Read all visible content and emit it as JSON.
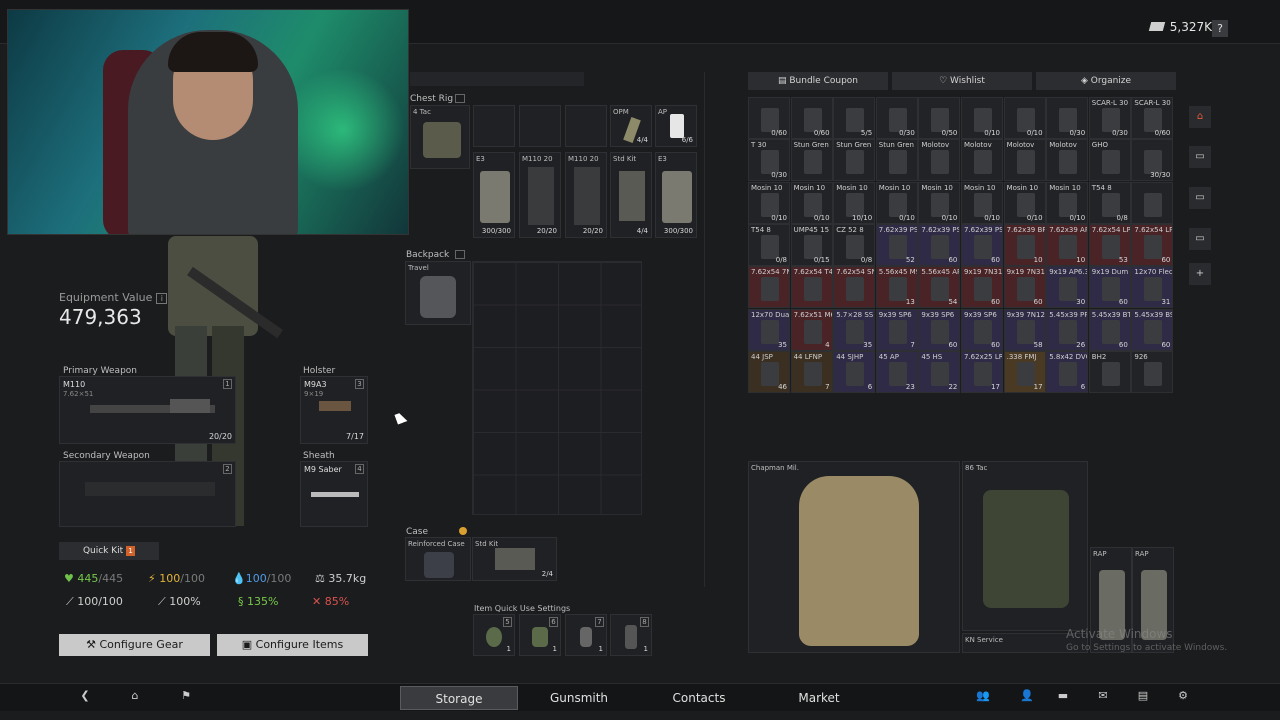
{
  "currency": {
    "amount": "5,327K",
    "help": "?"
  },
  "equipment": {
    "label": "Equipment Value",
    "value": "479,363"
  },
  "primary": {
    "title": "Primary Weapon",
    "name": "M110",
    "caliber": "7.62×51",
    "ammo": "20/20",
    "slot": "1"
  },
  "holster": {
    "title": "Holster",
    "name": "M9A3",
    "caliber": "9×19",
    "ammo": "7/17",
    "slot": "3"
  },
  "secondary": {
    "title": "Secondary Weapon",
    "slot": "2"
  },
  "sheath": {
    "title": "Sheath",
    "name": "M9 Saber",
    "slot": "4"
  },
  "quickkit": {
    "label": "Quick Kit",
    "badge": "1"
  },
  "stats": {
    "health": "445",
    "health_max": "/445",
    "energy": "100",
    "energy_max": "/100",
    "hydration": "100",
    "hydration_max": "/100",
    "weight": "35.7kg",
    "stat1": "100/100",
    "stat2": "100%",
    "stat3": "135%",
    "stat4": "85%"
  },
  "buttons": {
    "configure_gear": "Configure Gear",
    "configure_items": "Configure Items"
  },
  "rig": {
    "title": "Chest Rig",
    "name": "4 Tac",
    "items": [
      {
        "name": "OPM",
        "count": "4/4"
      },
      {
        "name": "AP",
        "count": "6/6"
      },
      {
        "name": "E3",
        "count": "300/300"
      },
      {
        "name": "M110 20",
        "count": "20/20"
      },
      {
        "name": "M110 20",
        "count": "20/20"
      },
      {
        "name": "Std Kit",
        "count": "4/4"
      },
      {
        "name": "E3",
        "count": "300/300"
      }
    ]
  },
  "backpack": {
    "title": "Backpack",
    "name": "Travel"
  },
  "case": {
    "title": "Case",
    "name": "Reinforced Case",
    "kit": "Std Kit",
    "count": "2/4"
  },
  "quickuse": {
    "title": "Item Quick Use Settings",
    "slots": [
      "5",
      "6",
      "7",
      "8"
    ],
    "counts": [
      "1",
      "1",
      "1",
      "1"
    ]
  },
  "stash_toolbar": {
    "bundle": "Bundle Coupon",
    "wishlist": "Wishlist",
    "organize": "Organize"
  },
  "stash": {
    "rows": [
      [
        {
          "n": "",
          "c": "0/60"
        },
        {
          "n": "",
          "c": "0/60"
        },
        {
          "n": "",
          "c": "5/5"
        },
        {
          "n": "",
          "c": "0/30"
        },
        {
          "n": "",
          "c": "0/50"
        },
        {
          "n": "",
          "c": "0/10"
        },
        {
          "n": "",
          "c": "0/10"
        },
        {
          "n": "",
          "c": "0/30"
        },
        {
          "n": "SCAR-L 30",
          "c": "0/30"
        },
        {
          "n": "SCAR-L 30",
          "c": "0/60"
        }
      ],
      [
        {
          "n": "T 30",
          "c": "0/30"
        },
        {
          "n": "Stun Gren",
          "c": ""
        },
        {
          "n": "Stun Gren",
          "c": ""
        },
        {
          "n": "Stun Gren",
          "c": ""
        },
        {
          "n": "Molotov",
          "c": ""
        },
        {
          "n": "Molotov",
          "c": ""
        },
        {
          "n": "Molotov",
          "c": ""
        },
        {
          "n": "Molotov",
          "c": ""
        },
        {
          "n": "GHO",
          "c": ""
        },
        {
          "n": "",
          "c": "30/30"
        }
      ],
      [
        {
          "n": "Mosin 10",
          "c": "0/10"
        },
        {
          "n": "Mosin 10",
          "c": "0/10"
        },
        {
          "n": "Mosin 10",
          "c": "10/10"
        },
        {
          "n": "Mosin 10",
          "c": "0/10"
        },
        {
          "n": "Mosin 10",
          "c": "0/10"
        },
        {
          "n": "Mosin 10",
          "c": "0/10"
        },
        {
          "n": "Mosin 10",
          "c": "0/10"
        },
        {
          "n": "Mosin 10",
          "c": "0/10"
        },
        {
          "n": "T54 8",
          "c": "0/8"
        },
        {
          "n": "",
          "c": ""
        }
      ],
      [
        {
          "n": "T54 8",
          "c": "0/8"
        },
        {
          "n": "UMP45 15",
          "c": "0/15"
        },
        {
          "n": "CZ 52 8",
          "c": "0/8"
        },
        {
          "n": "7.62x39 PS",
          "c": "52",
          "bg": "purple"
        },
        {
          "n": "7.62x39 PS",
          "c": "60",
          "bg": "purple"
        },
        {
          "n": "7.62x39 PS",
          "c": "60",
          "bg": "purple"
        },
        {
          "n": "7.62x39 BP",
          "c": "10",
          "bg": "red"
        },
        {
          "n": "7.62x39 AP",
          "c": "10",
          "bg": "red"
        },
        {
          "n": "7.62x54 LPS",
          "c": "53",
          "bg": "red"
        },
        {
          "n": "7.62x54 LPS",
          "c": "60",
          "bg": "red"
        }
      ],
      [
        {
          "n": "7.62x54 7N1",
          "c": "",
          "bg": "red"
        },
        {
          "n": "7.62x54 T46M",
          "c": "",
          "bg": "red"
        },
        {
          "n": "7.62x54 SNB",
          "c": "",
          "bg": "red"
        },
        {
          "n": "5.56x45 M995",
          "c": "13",
          "bg": "red"
        },
        {
          "n": "5.56x45 AP",
          "c": "54",
          "bg": "red"
        },
        {
          "n": "9x19 7N31",
          "c": "60",
          "bg": "red"
        },
        {
          "n": "9x19 7N31",
          "c": "60",
          "bg": "red"
        },
        {
          "n": "9x19 AP6.3",
          "c": "30",
          "bg": "purple"
        },
        {
          "n": "9x19 Dum",
          "c": "60",
          "bg": "purple"
        },
        {
          "n": "12x70 Flechette",
          "c": "31",
          "bg": "purple"
        }
      ],
      [
        {
          "n": "12x70 Dual",
          "c": "35",
          "bg": "purple"
        },
        {
          "n": "7.62x51 M61",
          "c": "4",
          "bg": "red"
        },
        {
          "n": "5.7×28 SS190",
          "c": "35",
          "bg": "purple"
        },
        {
          "n": "9x39 SP6",
          "c": "7",
          "bg": "purple"
        },
        {
          "n": "9x39 SP6",
          "c": "60",
          "bg": "purple"
        },
        {
          "n": "9x39 SP6",
          "c": "60",
          "bg": "purple"
        },
        {
          "n": "9x39 7N12",
          "c": "58",
          "bg": "purple"
        },
        {
          "n": "5.45x39 PP",
          "c": "26",
          "bg": "purple"
        },
        {
          "n": "5.45x39 BT",
          "c": "60",
          "bg": "purple"
        },
        {
          "n": "5.45x39 BS",
          "c": "60",
          "bg": "purple"
        }
      ],
      [
        {
          "n": "44 JSP",
          "c": "46",
          "bg": "brown"
        },
        {
          "n": "44 LFNP",
          "c": "7",
          "bg": "brown"
        },
        {
          "n": "44 SJHP",
          "c": "6",
          "bg": "purple"
        },
        {
          "n": "45 AP",
          "c": "23",
          "bg": "purple"
        },
        {
          "n": "45 HS",
          "c": "22",
          "bg": "purple"
        },
        {
          "n": "7.62x25 LRN",
          "c": "17",
          "bg": "purple"
        },
        {
          "n": ".338 FMJ",
          "c": "17",
          "bg": "orange"
        },
        {
          "n": "5.8x42 DVC",
          "c": "6",
          "bg": "purple"
        },
        {
          "n": "BH2",
          "c": ""
        },
        {
          "n": "926",
          "c": ""
        }
      ]
    ],
    "big_items": {
      "backpack": "Chapman Mil.",
      "rig": "86 Tac",
      "kn": "KN Service",
      "rap1": "RAP",
      "rap2": "RAP"
    }
  },
  "nav": {
    "tabs": [
      "Storage",
      "Gunsmith",
      "Contacts",
      "Market"
    ],
    "active": "Storage"
  },
  "watermark": {
    "line1": "Activate Windows",
    "line2": "Go to Settings to activate Windows."
  }
}
